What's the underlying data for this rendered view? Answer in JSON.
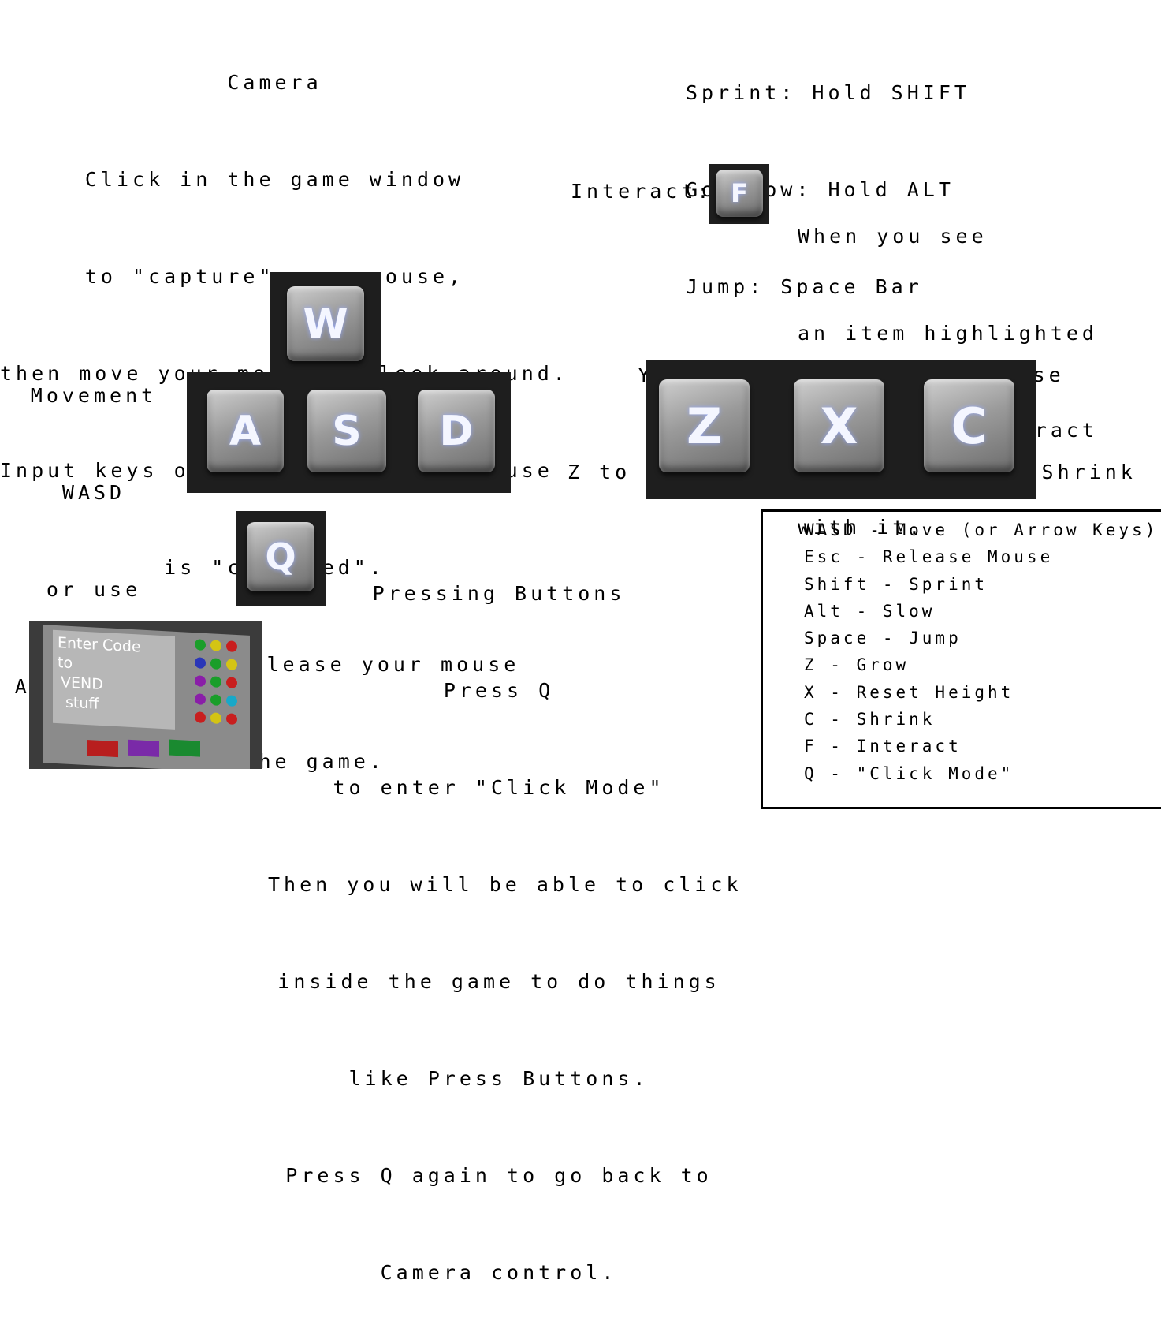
{
  "camera": {
    "lines": [
      "Camera",
      "Click in the game window",
      "to \"capture\" your mouse,",
      "then move your mouse to look around.",
      "Input keys only work when the mouse",
      "is \"captured\".",
      "Press Esc to release your mouse",
      "from the game."
    ]
  },
  "modifiers": {
    "lines": [
      "Sprint: Hold SHIFT",
      "Go SLow: Hold ALT",
      "Jump: Space Bar"
    ]
  },
  "interact": {
    "label": "Interact:",
    "key": "F",
    "lines": [
      "When you see",
      "an item highlighted",
      "press F to interact",
      "with it."
    ]
  },
  "movement": {
    "lines": [
      "Movement",
      "WASD",
      "or use",
      "Arrow Keys"
    ],
    "keys": {
      "w": "W",
      "a": "A",
      "s": "S",
      "d": "D"
    }
  },
  "grow": {
    "lines": [
      "You an grow and shrink. Use",
      "Z to Grow - X to Reset - C to Shrink"
    ],
    "keys": {
      "z": "Z",
      "x": "X",
      "c": "C"
    }
  },
  "buttons": {
    "key": "Q",
    "lines": [
      "Pressing Buttons",
      "Press Q",
      "to enter \"Click Mode\"",
      "Then you will be able to click",
      "inside the game to do things",
      "like Press Buttons.",
      "Press Q again to go back to",
      "Camera control."
    ]
  },
  "vend_screen": {
    "lines": [
      "Enter Code",
      "to",
      "VEND",
      "stuff"
    ]
  },
  "legend": {
    "items": [
      "WASD - Move (or Arrow Keys)",
      "Esc - Release Mouse",
      "Shift - Sprint",
      "Alt - Slow",
      "Space - Jump",
      "Z - Grow",
      "X - Reset Height",
      "C - Shrink",
      "F - Interact",
      "Q - \"Click Mode\""
    ]
  },
  "colors": {
    "key_block": "#1e1e1e",
    "vend_dots": [
      "#1a9e2a",
      "#d4c414",
      "#c81e1e",
      "#2a36b8",
      "#1a9e2a",
      "#d4c414",
      "#8a1ea8",
      "#1a9e2a",
      "#c81e1e",
      "#8a1ea8",
      "#1a9e2a",
      "#18a8c8",
      "#c81e1e",
      "#d4c414",
      "#c81e1e"
    ],
    "vend_buttons": [
      "#b81e1e",
      "#7a2aa8",
      "#1a8a30"
    ]
  }
}
